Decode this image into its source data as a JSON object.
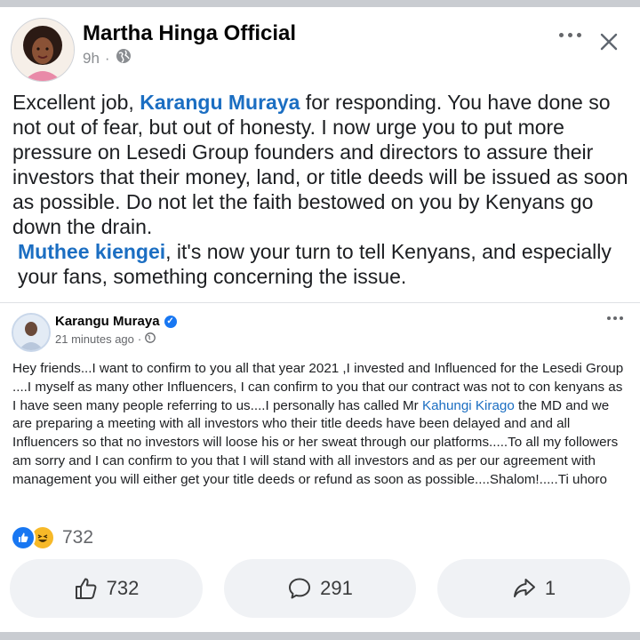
{
  "post": {
    "author": "Martha Hinga Official",
    "time": "9h",
    "separator": "·",
    "text_1_prefix": "Excellent job, ",
    "mention_1": "Karangu Muraya",
    "text_1_suffix": "  for responding. You have done so not out of fear, but out of honesty. I now urge you to put more pressure on Lesedi Group founders and directors to assure their investors that their money, land, or title deeds will be issued as soon as possible. Do not let the faith bestowed on you by Kenyans go down the drain.",
    "mention_2": "Muthee kiengei",
    "text_2_suffix": ", it's now your turn to tell Kenyans, and especially your fans, something concerning the issue."
  },
  "shared": {
    "author": "Karangu Muraya",
    "time": "21 minutes ago",
    "separator": "·",
    "text_prefix": "Hey friends...I want to confirm to you all that year 2021 ,I invested and Influenced for the Lesedi Group ....I myself as many other Influencers, I can confirm to you that our contract was not to con kenyans as I have seen many people referring to us....I personally has called Mr ",
    "link": "Kahungi Kirago",
    "text_suffix": " the MD and we are preparing a meeting with all investors who their title deeds have been delayed and and all Influencers so that no investors will loose his or her sweat through our platforms.....To all my followers am sorry and I can confirm to you that I will stand with all investors and as per our agreement with management you will either get your title deeds or refund as soon as possible....Shalom!.....Ti uhoro"
  },
  "reactions": {
    "count": "732",
    "icons": [
      "like-icon",
      "haha-icon"
    ]
  },
  "actions": {
    "like_count": "732",
    "comment_count": "291",
    "share_count": "1"
  },
  "colors": {
    "link": "#1b6ec2",
    "like_blue": "#1877f2",
    "haha_yellow": "#f7b928",
    "button_bg": "#f0f2f5"
  }
}
